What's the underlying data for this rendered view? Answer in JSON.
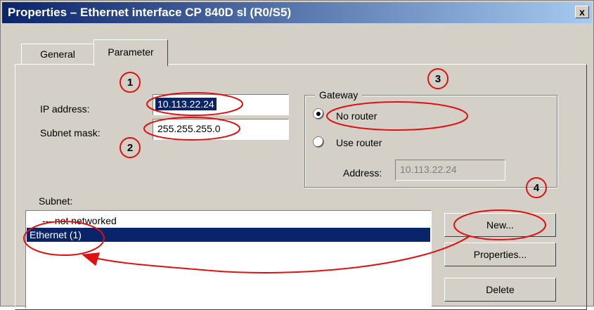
{
  "window": {
    "title": "Properties – Ethernet interface CP 840D sl (R0/S5)",
    "close_glyph": "x"
  },
  "tabs": [
    {
      "label": "General"
    },
    {
      "label": "Parameter"
    }
  ],
  "form": {
    "ip_label": "IP address:",
    "ip_value": "10.113.22.24",
    "subnet_label": "Subnet mask:",
    "subnet_value": "255.255.255.0"
  },
  "gateway": {
    "title": "Gateway",
    "no_router_label": "No router",
    "use_router_label": "Use router",
    "selected": "no_router",
    "address_label": "Address:",
    "address_value": "10.113.22.24"
  },
  "subnet": {
    "label": "Subnet:",
    "items": [
      {
        "label": "--- not networked"
      },
      {
        "label": "Ethernet (1)",
        "selected": true
      }
    ]
  },
  "buttons": {
    "new_label": "New...",
    "properties_label": "Properties...",
    "delete_label": "Delete"
  },
  "annotations": {
    "color": "#e01010",
    "markers": [
      "1",
      "2",
      "3",
      "4"
    ]
  }
}
